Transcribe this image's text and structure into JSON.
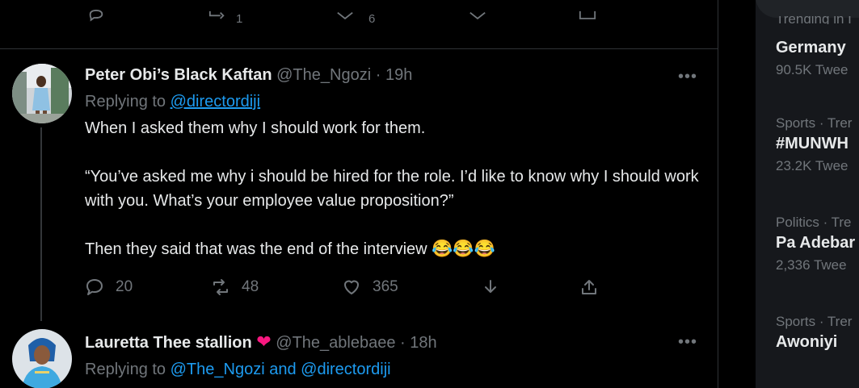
{
  "previous_tweet": {
    "retweet_count": "1",
    "like_count": "6"
  },
  "tweet1": {
    "display_name": "Peter Obi’s Black Kaftan",
    "handle": "@The_Ngozi",
    "separator": "·",
    "time": "19h",
    "replying_label": "Replying to",
    "replying_to": "@directordiji",
    "paragraph1": "When I asked them why I should work for them.",
    "paragraph2": "“You’ve asked me why i should be hired for the role. I’d like to know why I should work with you. What’s your employee value proposition?”",
    "paragraph3": "Then they said that was the end of the interview",
    "emojis": "😂😂😂",
    "reply_count": "20",
    "retweet_count": "48",
    "like_count": "365",
    "more_label": "•••"
  },
  "tweet2": {
    "display_name": "Lauretta Thee stallion",
    "heart": "❤",
    "handle": "@The_ablebaee",
    "separator": "·",
    "time": "18h",
    "replying_label": "Replying to",
    "replying_to_1": "@The_Ngozi",
    "and_label": "and",
    "replying_to_2": "@directordiji",
    "more_label": "•••"
  },
  "sidebar": {
    "header_partial": "Trending in I",
    "trends": [
      {
        "context": "",
        "name": "Germany",
        "count": "90.5K Twee"
      },
      {
        "context": "Sports · Trer",
        "name": "#MUNWH",
        "count": "23.2K Twee"
      },
      {
        "context": "Politics · Tre",
        "name": "Pa Adebar",
        "count": "2,336 Twee"
      },
      {
        "context": "Sports · Trer",
        "name": "Awoniyi",
        "count": ""
      }
    ]
  },
  "colors": {
    "background": "#000000",
    "text": "#e7e9ea",
    "secondary": "#71767b",
    "link": "#1d9bf0",
    "heart": "#f91880",
    "sidebar": "#16181c"
  }
}
